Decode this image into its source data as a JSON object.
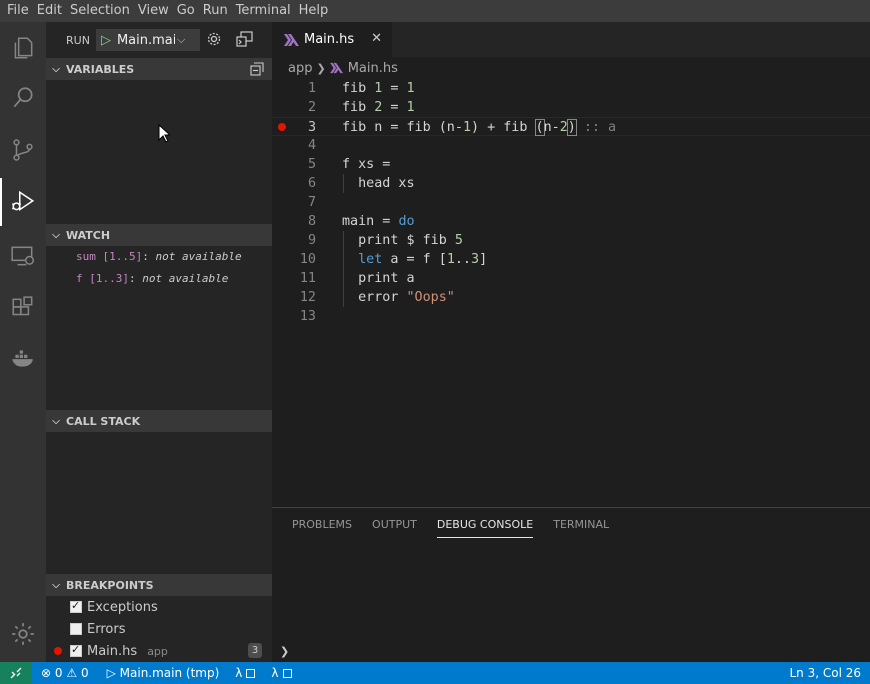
{
  "menu": [
    "File",
    "Edit",
    "Selection",
    "View",
    "Go",
    "Run",
    "Terminal",
    "Help"
  ],
  "activity": [
    "explorer-icon",
    "search-icon",
    "source-control-icon",
    "run-debug-icon",
    "remote-explorer-icon",
    "extensions-icon",
    "docker-icon",
    "manage-gear-icon"
  ],
  "run": {
    "label": "RUN",
    "config": "Main.main"
  },
  "sections": {
    "variables": "VARIABLES",
    "watch": "WATCH",
    "callstack": "CALL STACK",
    "breakpoints": "BREAKPOINTS"
  },
  "watch": [
    {
      "expr": "sum [1..5]",
      "value": "not available"
    },
    {
      "expr": "f [1..3]",
      "value": "not available"
    }
  ],
  "breakpoints": [
    {
      "label": "Exceptions",
      "checked": true
    },
    {
      "label": "Errors",
      "checked": false
    },
    {
      "label": "Main.hs",
      "desc": "app",
      "count": "3",
      "checked": true
    }
  ],
  "tab": {
    "name": "Main.hs",
    "close": "✕"
  },
  "breadcrumb": {
    "folder": "app",
    "file": "Main.hs"
  },
  "lines": [
    "1",
    "2",
    "3",
    "4",
    "5",
    "6",
    "7",
    "8",
    "9",
    "10",
    "11",
    "12",
    "13"
  ],
  "panel": {
    "tabs": [
      "PROBLEMS",
      "OUTPUT",
      "DEBUG CONSOLE",
      "TERMINAL"
    ],
    "active": "DEBUG CONSOLE",
    "prompt": "❯"
  },
  "status": {
    "errors": "0",
    "warnings": "0",
    "launch": "Main.main (tmp)",
    "lambda1": "λ",
    "lambda2": "λ",
    "position": "Ln 3, Col 26"
  },
  "colors": {
    "statusbar": "#007acc",
    "remote": "#16825d",
    "breakpoint": "#e51400"
  }
}
